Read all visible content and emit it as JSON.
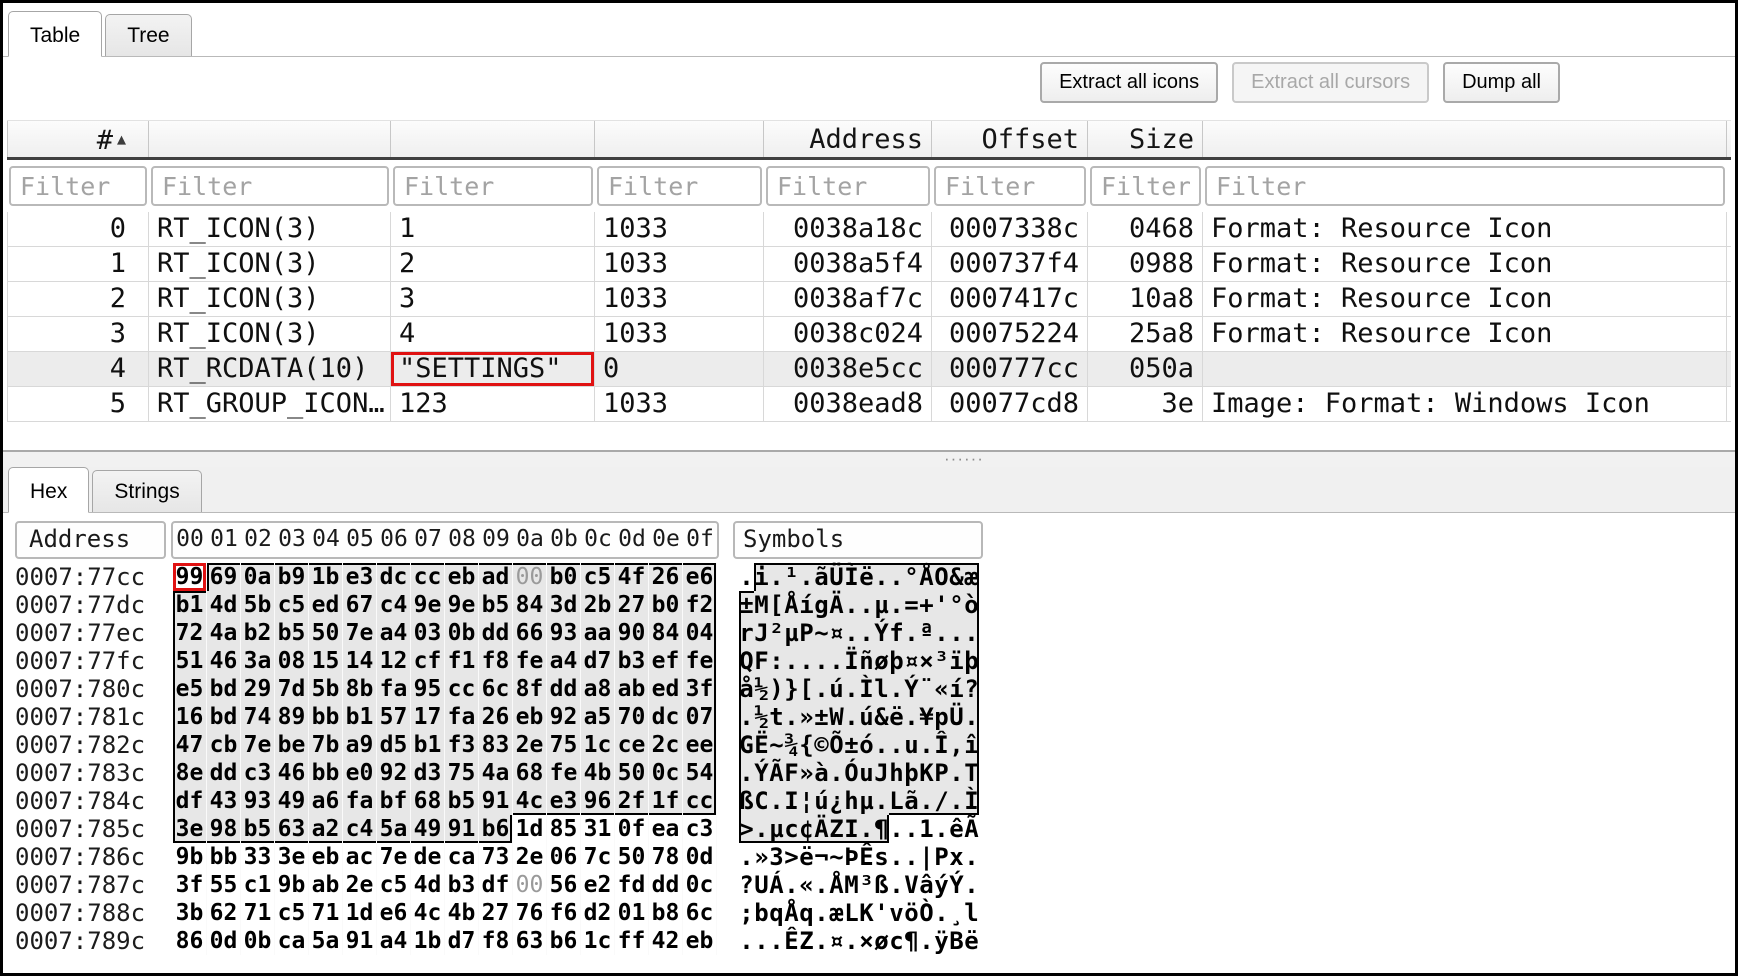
{
  "top_tabs": {
    "items": [
      {
        "label": "Table",
        "active": true
      },
      {
        "label": "Tree",
        "active": false
      }
    ]
  },
  "toolbar": {
    "buttons": [
      {
        "label": "Extract all icons",
        "enabled": true
      },
      {
        "label": "Extract all cursors",
        "enabled": false
      },
      {
        "label": "Dump all",
        "enabled": true
      }
    ]
  },
  "resource_table": {
    "columns": [
      {
        "label": "#",
        "align": "right",
        "sort": "asc"
      },
      {
        "label": "",
        "align": "left"
      },
      {
        "label": "",
        "align": "left"
      },
      {
        "label": "",
        "align": "left"
      },
      {
        "label": "Address",
        "align": "right"
      },
      {
        "label": "Offset",
        "align": "right"
      },
      {
        "label": "Size",
        "align": "right"
      },
      {
        "label": "",
        "align": "left"
      }
    ],
    "filter_placeholder": "Filter",
    "rows": [
      {
        "cells": [
          "0",
          "RT_ICON(3)",
          "1",
          "1033",
          "0038a18c",
          "0007338c",
          "0468",
          "Format: Resource Icon"
        ]
      },
      {
        "cells": [
          "1",
          "RT_ICON(3)",
          "2",
          "1033",
          "0038a5f4",
          "000737f4",
          "0988",
          "Format: Resource Icon"
        ]
      },
      {
        "cells": [
          "2",
          "RT_ICON(3)",
          "3",
          "1033",
          "0038af7c",
          "0007417c",
          "10a8",
          "Format: Resource Icon"
        ]
      },
      {
        "cells": [
          "3",
          "RT_ICON(3)",
          "4",
          "1033",
          "0038c024",
          "00075224",
          "25a8",
          "Format: Resource Icon"
        ]
      },
      {
        "cells": [
          "4",
          "RT_RCDATA(10)",
          "\"SETTINGS\"",
          "0",
          "0038e5cc",
          "000777cc",
          "050a",
          ""
        ]
      },
      {
        "cells": [
          "5",
          "RT_GROUP_ICON…",
          "123",
          "1033",
          "0038ead8",
          "00077cd8",
          "3e",
          "Image: Format: Windows Icon"
        ]
      }
    ],
    "selected_row": 4,
    "red_highlight_cell": {
      "row": 4,
      "col": 2
    }
  },
  "splitter": {
    "dots": "······"
  },
  "bottom_tabs": {
    "items": [
      {
        "label": "Hex",
        "active": true
      },
      {
        "label": "Strings",
        "active": false
      }
    ]
  },
  "hex_view": {
    "address_header": "Address",
    "byte_header": [
      "00",
      "01",
      "02",
      "03",
      "04",
      "05",
      "06",
      "07",
      "08",
      "09",
      "0a",
      "0b",
      "0c",
      "0d",
      "0e",
      "0f"
    ],
    "symbols_header": "Symbols",
    "rows": [
      {
        "address": "0007:77cc",
        "bytes": "99 69 0a b9 1b e3 dc cc eb ad 00 b0 c5 4f 26 e6",
        "symbols": ".i.¹.ãÜÌë..°ÅO&æ"
      },
      {
        "address": "0007:77dc",
        "bytes": "b1 4d 5b c5 ed 67 c4 9e 9e b5 84 3d 2b 27 b0 f2",
        "symbols": "±M[ÅígÄ..µ.=+'°ò"
      },
      {
        "address": "0007:77ec",
        "bytes": "72 4a b2 b5 50 7e a4 03 0b dd 66 93 aa 90 84 04",
        "symbols": "rJ²µP~¤..Ýf.ª..."
      },
      {
        "address": "0007:77fc",
        "bytes": "51 46 3a 08 15 14 12 cf f1 f8 fe a4 d7 b3 ef fe",
        "symbols": "QF:....Ïñøþ¤×³ïþ"
      },
      {
        "address": "0007:780c",
        "bytes": "e5 bd 29 7d 5b 8b fa 95 cc 6c 8f dd a8 ab ed 3f",
        "symbols": "å½)}[.ú.Ìl.Ý¨«í?"
      },
      {
        "address": "0007:781c",
        "bytes": "16 bd 74 89 bb b1 57 17 fa 26 eb 92 a5 70 dc 07",
        "symbols": ".½t.»±W.ú&ë.¥pÜ."
      },
      {
        "address": "0007:782c",
        "bytes": "47 cb 7e be 7b a9 d5 b1 f3 83 2e 75 1c ce 2c ee",
        "symbols": "GË~¾{©Õ±ó..u.Î,î"
      },
      {
        "address": "0007:783c",
        "bytes": "8e dd c3 46 bb e0 92 d3 75 4a 68 fe 4b 50 0c 54",
        "symbols": ".ÝÃF»à.ÓuJhþKP.T"
      },
      {
        "address": "0007:784c",
        "bytes": "df 43 93 49 a6 fa bf 68 b5 91 4c e3 96 2f 1f cc",
        "symbols": "ßC.I¦ú¿hµ.Lã./.Ì"
      },
      {
        "address": "0007:785c",
        "bytes": "3e 98 b5 63 a2 c4 5a 49 91 b6 1d 85 31 0f ea c3",
        "symbols": ">.µc¢ÄZI.¶..1.êÃ"
      },
      {
        "address": "0007:786c",
        "bytes": "9b bb 33 3e eb ac 7e de ca 73 2e 06 7c 50 78 0d",
        "symbols": ".»3>ë¬~ÞÊs..|Px."
      },
      {
        "address": "0007:787c",
        "bytes": "3f 55 c1 9b ab 2e c5 4d b3 df 00 56 e2 fd dd 0c",
        "symbols": "?UÁ.«.ÅM³ß.VâýÝ."
      },
      {
        "address": "0007:788c",
        "bytes": "3b 62 71 c5 71 1d e6 4c 4b 27 76 f6 d2 01 b8 6c",
        "symbols": ";bqÅq.æLK'vöÒ.¸l"
      },
      {
        "address": "0007:789c",
        "bytes": "86 0d 0b ca 5a 91 a4 1b d7 f8 63 b6 1c ff 42 eb",
        "symbols": "...ÊZ.¤.×øc¶.ÿBë"
      }
    ],
    "selection": {
      "start": 1,
      "end": 153
    },
    "cursor_index": 0,
    "colors": {
      "selection_bg": "#e7e7e7",
      "highlight_red": "#e01212",
      "muted_byte": "#9a9a9a"
    }
  }
}
